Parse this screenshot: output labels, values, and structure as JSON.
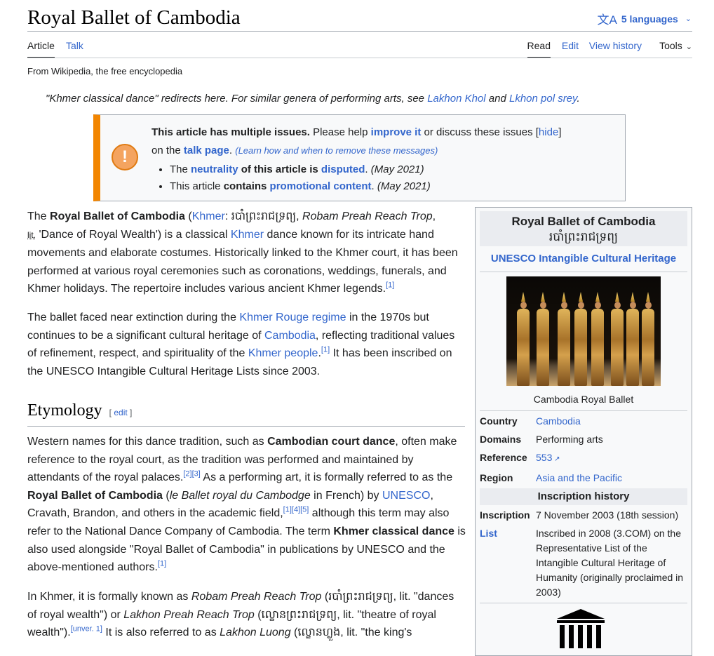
{
  "header": {
    "title": "Royal Ballet of Cambodia",
    "languages": "5 languages",
    "tabs": {
      "article": "Article",
      "talk": "Talk",
      "read": "Read",
      "edit": "Edit",
      "history": "View history",
      "tools": "Tools"
    },
    "from": "From Wikipedia, the free encyclopedia"
  },
  "hatnote": {
    "pre": "\"Khmer classical dance\" redirects here. For similar genera of performing arts, see ",
    "link1": "Lakhon Khol",
    "mid": " and ",
    "link2": "Lkhon pol srey",
    "post": "."
  },
  "ambox": {
    "bold": "This article has multiple issues.",
    "t1": " Please help ",
    "improve": "improve it",
    "t2": " or discuss these issues ",
    "hide_open": " [",
    "hide": "hide",
    "hide_close": "]",
    "t3": "on the ",
    "talk": "talk page",
    "t4": ". ",
    "learn": "(Learn how and when to remove these messages)",
    "b1_pre": "The ",
    "b1_neutrality": "neutrality",
    "b1_mid": " of this article is ",
    "b1_disputed": "disputed",
    "b1_date": "(May 2021)",
    "b2_pre": "This article ",
    "b2_contains": "contains",
    "b2_link": "promotional content",
    "b2_date": "(May 2021)"
  },
  "p1": {
    "t1": "The ",
    "b": "Royal Ballet of Cambodia",
    "t2": " (",
    "khmer_link": "Khmer",
    "t3": ": របាំព្រះរាជទ្រព្យ, ",
    "rom": "Robam Preah Reach Trop",
    "t4": ",",
    "lit": "lit.",
    "t5": " 'Dance of Royal Wealth') is a classical ",
    "khmer2": "Khmer",
    "t6": " dance known for its intricate hand movements and elaborate costumes. Historically linked to the Khmer court, it has been performed at various royal ceremonies such as coronations, weddings, funerals, and Khmer holidays. The repertoire includes various ancient Khmer legends.",
    "ref": "[1]"
  },
  "p2": {
    "t1": "The ballet faced near extinction during the ",
    "link1": "Khmer Rouge regime",
    "t2": " in the 1970s but continues to be a significant cultural heritage of ",
    "link2": "Cambodia",
    "t3": ", reflecting traditional values of refinement, respect, and spirituality of the ",
    "link3": "Khmer people",
    "t4": ".",
    "ref": "[1]",
    "t5": " It has been inscribed on the UNESCO Intangible Cultural Heritage Lists since 2003."
  },
  "etymology": {
    "title": "Etymology",
    "edit": "edit",
    "edit_open": "[ ",
    "edit_close": " ]"
  },
  "p3": {
    "t1": "Western names for this dance tradition, such as ",
    "b1": "Cambodian court dance",
    "t2": ", often make reference to the royal court, as the tradition was performed and maintained by attendants of the royal palaces.",
    "ref1": "[2][3]",
    "t3": " As a performing art, it is formally referred to as the ",
    "b2": "Royal Ballet of Cambodia",
    "t4": " (",
    "i1": "le Ballet royal du Cambodge",
    "t5": " in French) by ",
    "link1": "UNESCO",
    "t6": ", Cravath, Brandon, and others in the academic field,",
    "ref2": "[1][4][5]",
    "t7": " although this term may also refer to the National Dance Company of Cambodia. The term ",
    "b3": "Khmer classical dance",
    "t8": " is also used alongside \"Royal Ballet of Cambodia\" in publications by UNESCO and the above-mentioned authors.",
    "ref3": "[1]"
  },
  "p4": {
    "t1": "In Khmer, it is formally known as ",
    "i1": "Robam Preah Reach Trop",
    "t2": " (របាំព្រះរាជទ្រព្យ, lit. \"dances of royal wealth\") or ",
    "i2": "Lakhon Preah Reach Trop",
    "t3": " (ល្ខោនព្រះរាជទ្រព្យ, lit. \"theatre of royal wealth\").",
    "ref": "[unver. 1]",
    "t4": " It is also referred to as ",
    "i3": "Lakhon Luong",
    "t5": " (ល្ខោនហ្លួង, lit. \"the king's"
  },
  "infobox": {
    "title": "Royal Ballet of Cambodia",
    "khmer": "របាំព្រះរាជទ្រព្យ",
    "subtitle": "UNESCO Intangible Cultural Heritage",
    "caption": "Cambodia Royal Ballet",
    "rows": [
      {
        "label": "Country",
        "value": "Cambodia"
      },
      {
        "label": "Domains",
        "value": "Performing arts"
      },
      {
        "label": "Reference",
        "value": "553"
      },
      {
        "label": "Region",
        "value": "Asia and the Pacific"
      }
    ],
    "history_title": "Inscription history",
    "inscription_label": "Inscription",
    "inscription_value": "7 November 2003 (18th session)",
    "list_label": "List",
    "list_value": "Inscribed in 2008 (3.COM) on the Representative List of the Intangible Cultural Heritage of Humanity (originally proclaimed in 2003)"
  },
  "colors": {
    "link": "#3366cc",
    "ambox_accent": "#f28500",
    "infobox_bg": "#f8f9fa"
  },
  "icons": [
    "translate-icon",
    "chevron-down-icon",
    "warning-icon",
    "external-link-icon",
    "unesco-logo-icon"
  ]
}
